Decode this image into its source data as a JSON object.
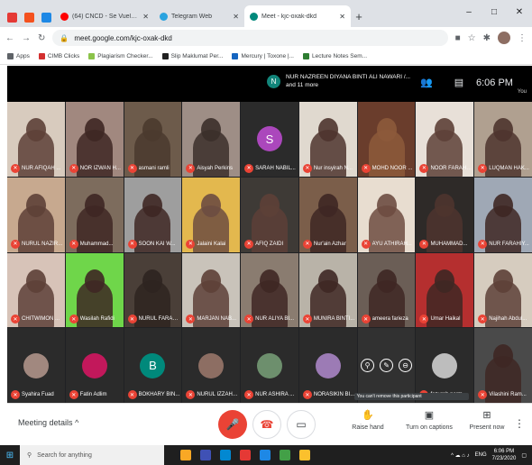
{
  "browser": {
    "pinned_tabs": [
      {
        "name": "pinned-tab-1",
        "color": "#e53935"
      },
      {
        "name": "pinned-tab-2",
        "color": "#f4511e"
      },
      {
        "name": "pinned-tab-3",
        "color": "#1e88e5"
      }
    ],
    "tabs": [
      {
        "label": "(64) CNCD - Se Vuelve Loco (Lir...",
        "icon_color": "#ff0000",
        "active": false
      },
      {
        "label": "Telegram Web",
        "icon_color": "#2aa3df",
        "active": false
      },
      {
        "label": "Meet - kjc-oxak-dkd",
        "icon_color": "#00897b",
        "active": true
      }
    ],
    "new_tab": "+",
    "window_controls": [
      "–",
      "□",
      "✕"
    ],
    "url": "meet.google.com/kjc-oxak-dkd",
    "bookmarks": [
      {
        "label": "Apps",
        "color": "#5f6368"
      },
      {
        "label": "CIMB Clicks",
        "color": "#d32f2f"
      },
      {
        "label": "Plagiarism Checker...",
        "color": "#8bc34a"
      },
      {
        "label": "Slip Maklumat Per...",
        "color": "#212121"
      },
      {
        "label": "Mercury | Toxone |...",
        "color": "#1565c0"
      },
      {
        "label": "Lecture Notes Sem...",
        "color": "#2e7d32"
      }
    ]
  },
  "meet": {
    "presenter_initial": "N",
    "presenter_name": "NUR NAZREEN DIYANA BINTI ALI NAWARI /...",
    "presenter_more": "and 11 more",
    "time": "6:06 PM",
    "you_label": "You",
    "tiles": [
      {
        "name": "NUR AFIQAH ...",
        "bg": "#d8cbbe",
        "skin": "#5d4037",
        "initial": ""
      },
      {
        "name": "NOR IZWAN H...",
        "bg": "#a1887f",
        "skin": "#3e2723",
        "initial": ""
      },
      {
        "name": "asmani ramli",
        "bg": "#6d5b4b",
        "skin": "#4a3a2e",
        "initial": ""
      },
      {
        "name": "Aisyah Perkins",
        "bg": "#9e8e86",
        "skin": "#3b2f2a",
        "initial": ""
      },
      {
        "name": "SARAH NABIL...",
        "bg": "#2b2b2b",
        "skin": "",
        "initial": "S",
        "avatar_color": "#ab47bc"
      },
      {
        "name": "Nur insyirah N...",
        "bg": "#e0d9cf",
        "skin": "#4e342e",
        "initial": ""
      },
      {
        "name": "MOHD NOOR ...",
        "bg": "#6a3d2c",
        "skin": "#8d5a3b",
        "initial": ""
      },
      {
        "name": "NOOR FARAH ...",
        "bg": "#e8e0d8",
        "skin": "#5d4037",
        "initial": ""
      },
      {
        "name": "LUQMAN HAK...",
        "bg": "#b0a090",
        "skin": "#4e342e",
        "initial": ""
      },
      {
        "name": "NURUL NAZIR...",
        "bg": "#c7a98f",
        "skin": "#5d4037",
        "initial": ""
      },
      {
        "name": "Muhammad...",
        "bg": "#7d6c5d",
        "skin": "#3e2723",
        "initial": ""
      },
      {
        "name": "SOON KAI W...",
        "bg": "#9e9e9e",
        "skin": "#3e2723",
        "initial": ""
      },
      {
        "name": "Jalaini Kalai",
        "bg": "#e3b84e",
        "skin": "#6d4c41",
        "initial": ""
      },
      {
        "name": "AFIQ ZAIDI",
        "bg": "#3e3a36",
        "skin": "#5d4037",
        "initial": ""
      },
      {
        "name": "Nur'ain Azhar",
        "bg": "#7b5e4a",
        "skin": "#3e2723",
        "initial": ""
      },
      {
        "name": "AYU ATHIRAH...",
        "bg": "#e8ddd0",
        "skin": "#6d4c41",
        "initial": ""
      },
      {
        "name": "MUHAMMAD...",
        "bg": "#2e2a28",
        "skin": "#4e342e",
        "initial": ""
      },
      {
        "name": "NUR FARAHIY...",
        "bg": "#9fa8b5",
        "skin": "#3e2723",
        "initial": ""
      },
      {
        "name": "CHITWIMON ...",
        "bg": "#d7c3b8",
        "skin": "#5d4037",
        "initial": ""
      },
      {
        "name": "Wasilah Rafidi",
        "bg": "#6fd64a",
        "skin": "#3e2723",
        "initial": ""
      },
      {
        "name": "NURUL FARAH...",
        "bg": "#4a3f38",
        "skin": "#2e2420",
        "initial": ""
      },
      {
        "name": "MARJAN NAB...",
        "bg": "#c9c3ba",
        "skin": "#5d4037",
        "initial": ""
      },
      {
        "name": "NUR ALIYA BI...",
        "bg": "#8a7c70",
        "skin": "#3e2723",
        "initial": ""
      },
      {
        "name": "MUNIRA BINTI...",
        "bg": "#b9b3a8",
        "skin": "#3e2723",
        "initial": ""
      },
      {
        "name": "ameera farieza",
        "bg": "#6b5e56",
        "skin": "#3e2723",
        "initial": ""
      },
      {
        "name": "Umar Haikal",
        "bg": "#b52f2f",
        "skin": "#3e2723",
        "initial": ""
      },
      {
        "name": "Najihah Abdul...",
        "bg": "#d6ccbf",
        "skin": "#5d4037",
        "initial": ""
      },
      {
        "name": "Syahira Fuad",
        "bg": "#2b2b2b",
        "skin": "",
        "initial": "",
        "avatar_color": "#a1887f"
      },
      {
        "name": "Fatin Adlim",
        "bg": "#2b2b2b",
        "skin": "",
        "initial": "",
        "avatar_color": "#c2185b"
      },
      {
        "name": "BOKHARY BIN...",
        "bg": "#2b2b2b",
        "skin": "",
        "initial": "B",
        "avatar_color": "#00897b"
      },
      {
        "name": "NURUL IZZAH ...",
        "bg": "#2b2b2b",
        "skin": "",
        "initial": "",
        "avatar_color": "#8d6e63"
      },
      {
        "name": "NUR ASHIRA ...",
        "bg": "#2b2b2b",
        "skin": "",
        "initial": "",
        "avatar_color": "#6d8f6d"
      },
      {
        "name": "NORASIKIN BI...",
        "bg": "#2b2b2b",
        "skin": "",
        "initial": "",
        "avatar_color": "#9c7bb5"
      },
      {
        "name": "",
        "bg": "#5a5a5a",
        "skin": "",
        "initial": "",
        "overlay": true
      },
      {
        "name": "fazurah norm...",
        "bg": "#2b2b2b",
        "skin": "",
        "initial": "",
        "avatar_color": "#bdbdbd"
      },
      {
        "name": "Vilashini Ram...",
        "bg": "#4a4a4a",
        "skin": "#3e2723",
        "initial": ""
      }
    ],
    "overlay_tip": "You can't remove this participant",
    "controls": {
      "meeting_details": "Meeting details",
      "raise_hand": "Raise hand",
      "captions": "Turn on captions",
      "present": "Present now"
    }
  },
  "taskbar": {
    "search_placeholder": "Search for anything",
    "lang": "ENG",
    "time": "6:06 PM",
    "date": "7/23/2020"
  }
}
